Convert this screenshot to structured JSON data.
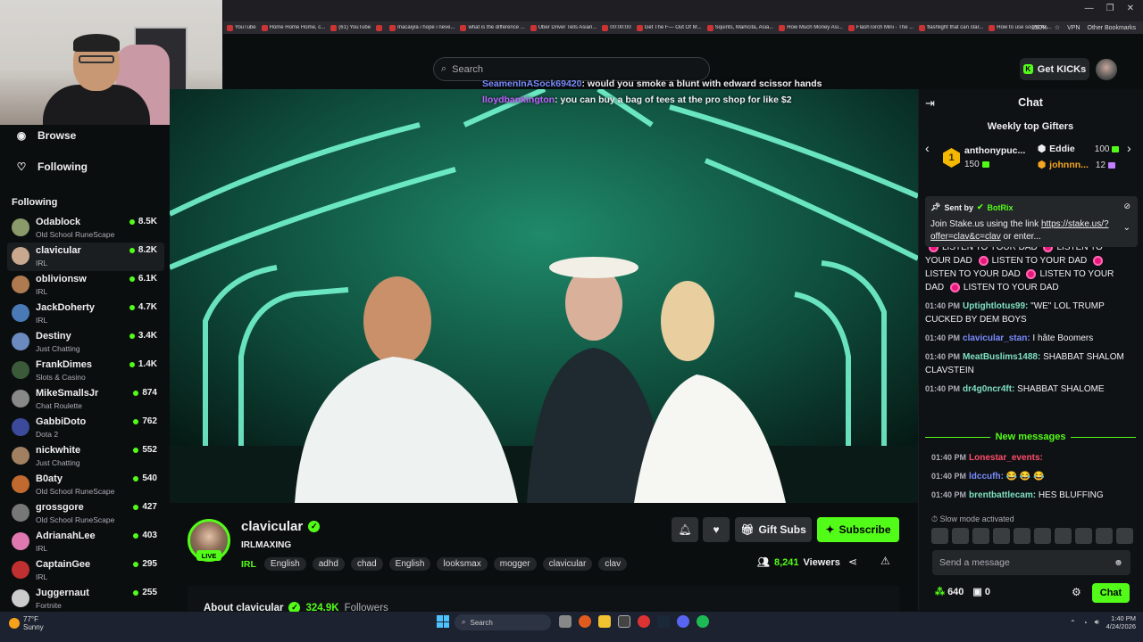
{
  "browser": {
    "bookmarks": [
      "YouTube",
      "Home Home Home, c...",
      "(61) YouTube",
      "",
      "macaiyla i hope i neve...",
      "what is the difference ...",
      "Uber Driver Tells Asian...",
      "00:00:00",
      "Get The F— Out Of M...",
      "Squints, Mamcita, Asia...",
      "How Much Money Asi...",
      "FlashTorch Mini - The ...",
      "flashlight that can star...",
      "How to use sound to ..."
    ],
    "other_bookmarks": "Other Bookmarks",
    "zoom": "150%",
    "vpn": "VPN"
  },
  "header": {
    "search_placeholder": "Search",
    "get_kicks": "Get KICKs"
  },
  "sidebar": {
    "nav": [
      {
        "label": "Browse",
        "icon": "compass-icon"
      },
      {
        "label": "Following",
        "icon": "heart-icon"
      }
    ],
    "following_title": "Following",
    "channels": [
      {
        "name": "Odablock",
        "category": "Old School RuneScape",
        "viewers": "8.5K",
        "color": "#8a9a6a"
      },
      {
        "name": "clavicular",
        "category": "IRL",
        "viewers": "8.2K",
        "color": "#c9a890",
        "active": true
      },
      {
        "name": "oblivionsw",
        "category": "IRL",
        "viewers": "6.1K",
        "color": "#b07a50"
      },
      {
        "name": "JackDoherty",
        "category": "IRL",
        "viewers": "4.7K",
        "color": "#4a7ab5"
      },
      {
        "name": "Destiny",
        "category": "Just Chatting",
        "viewers": "3.4K",
        "color": "#6a8ac0"
      },
      {
        "name": "FrankDimes",
        "category": "Slots & Casino",
        "viewers": "1.4K",
        "color": "#3a5a3a"
      },
      {
        "name": "MikeSmallsJr",
        "category": "Chat Roulette",
        "viewers": "874",
        "color": "#888"
      },
      {
        "name": "GabbiDoto",
        "category": "Dota 2",
        "viewers": "762",
        "color": "#3b4a9a"
      },
      {
        "name": "nickwhite",
        "category": "Just Chatting",
        "viewers": "552",
        "color": "#a08060"
      },
      {
        "name": "B0aty",
        "category": "Old School RuneScape",
        "viewers": "540",
        "color": "#c06a30"
      },
      {
        "name": "grossgore",
        "category": "Old School RuneScape",
        "viewers": "427",
        "color": "#777"
      },
      {
        "name": "AdrianahLee",
        "category": "IRL",
        "viewers": "403",
        "color": "#e078b0"
      },
      {
        "name": "CaptainGee",
        "category": "IRL",
        "viewers": "295",
        "color": "#c03030"
      },
      {
        "name": "Juggernaut",
        "category": "Fortnite",
        "viewers": "255",
        "color": "#ccc"
      }
    ]
  },
  "overlay_chat": [
    {
      "user": "SeamenInASock69420",
      "text": ": would you smoke a blunt with edward scissor hands",
      "color": "#7a8cff"
    },
    {
      "user": "lloydbankington",
      "text": ": you can buy a bag of tees at the pro shop for like $2",
      "color": "#c060ff"
    }
  ],
  "stream": {
    "streamer": "clavicular",
    "live": "LIVE",
    "title": "IRLMAXING",
    "category": "IRL",
    "tags": [
      "English",
      "adhd",
      "chad",
      "English",
      "looksmax",
      "mogger",
      "clavicular",
      "clav"
    ],
    "gift_subs": "Gift Subs",
    "subscribe": "Subscribe",
    "viewers_count": "8,241",
    "viewers_label": "Viewers",
    "about": "About clavicular",
    "followers_count": "324.9K",
    "followers_label": "Followers"
  },
  "chat": {
    "title": "Chat",
    "gifters_title": "Weekly top Gifters",
    "gifters": [
      {
        "name": "anthonypuc...",
        "amount": "150"
      },
      {
        "name": "Eddie",
        "amount": "100"
      },
      {
        "name": "johnnn...",
        "amount": "12"
      }
    ],
    "rank": "1",
    "pinned_sent_by": "Sent by",
    "pinned_bot": "BotRix",
    "pinned_text": "Join Stake.us using the link ",
    "pinned_link": "https://stake.us/?offer=clav&c=clav",
    "pinned_tail": " or enter...",
    "spam_word": "LISTEN TO YOUR DAD",
    "messages": [
      {
        "time": "01:40 PM",
        "user": "Uptightlotus99:",
        "text": " \"WE\" LOL TRUMP CUCKED BY DEM BOYS",
        "color": "#7fe0c0"
      },
      {
        "time": "01:40 PM",
        "user": "clavicular_stan:",
        "text": " I hâte Boomers",
        "color": "#7a8cff"
      },
      {
        "time": "01:40 PM",
        "user": "MeatBuslims1488:",
        "text": " SHABBAT SHALOM CLAVSTEIN",
        "color": "#7fe0c0"
      },
      {
        "time": "01:40 PM",
        "user": "dr4g0ncr4ft:",
        "text": " SHABBAT SHALOME",
        "color": "#7fe0c0"
      }
    ],
    "new_messages": "New messages",
    "new_msgs": [
      {
        "time": "01:40 PM",
        "user": "Lonestar_events:",
        "text": "",
        "color": "#ff4d6a"
      },
      {
        "time": "01:40 PM",
        "user": "ldccufh:",
        "text": " 😂 😂 😂",
        "color": "#7a8cff"
      },
      {
        "time": "01:40 PM",
        "user": "brentbattlecam:",
        "text": " HES BLUFFING",
        "color": "#7fe0c0"
      }
    ],
    "slow_mode": "Slow mode activated",
    "input_placeholder": "Send a message",
    "kicks_balance": "640",
    "other_balance": "0",
    "send": "Chat"
  },
  "taskbar": {
    "weather_temp": "77°F",
    "weather_desc": "Sunny",
    "search": "Search",
    "time": "1:40 PM",
    "date": "4/24/2026"
  }
}
